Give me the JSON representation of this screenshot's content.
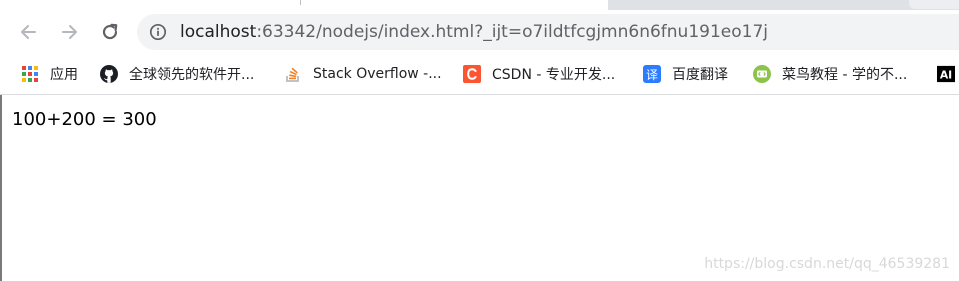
{
  "browser": {
    "address_bar": {
      "host": "localhost",
      "rest": ":63342/nodejs/index.html?_ijt=o7ildtfcgjmn6n6fnu191eo17j"
    }
  },
  "bookmarks": [
    {
      "label": "应用",
      "icon": "apps-grid-icon"
    },
    {
      "label": "全球领先的软件开...",
      "icon": "github-icon"
    },
    {
      "label": "Stack Overflow -...",
      "icon": "stackoverflow-icon"
    },
    {
      "label": "CSDN - 专业开发...",
      "icon": "csdn-icon"
    },
    {
      "label": "百度翻译",
      "icon": "translate-icon"
    },
    {
      "label": "菜鸟教程 - 学的不...",
      "icon": "runoob-icon"
    },
    {
      "label": "",
      "icon": "ai-icon"
    }
  ],
  "page": {
    "result_text": "100+200 = 300",
    "watermark": "https://blog.csdn.net/qq_46539281"
  },
  "colors": {
    "omnibox_bg": "#f1f3f4",
    "csdn": "#fc5531",
    "translate": "#2b7cff",
    "runoob": "#8cc34b"
  }
}
